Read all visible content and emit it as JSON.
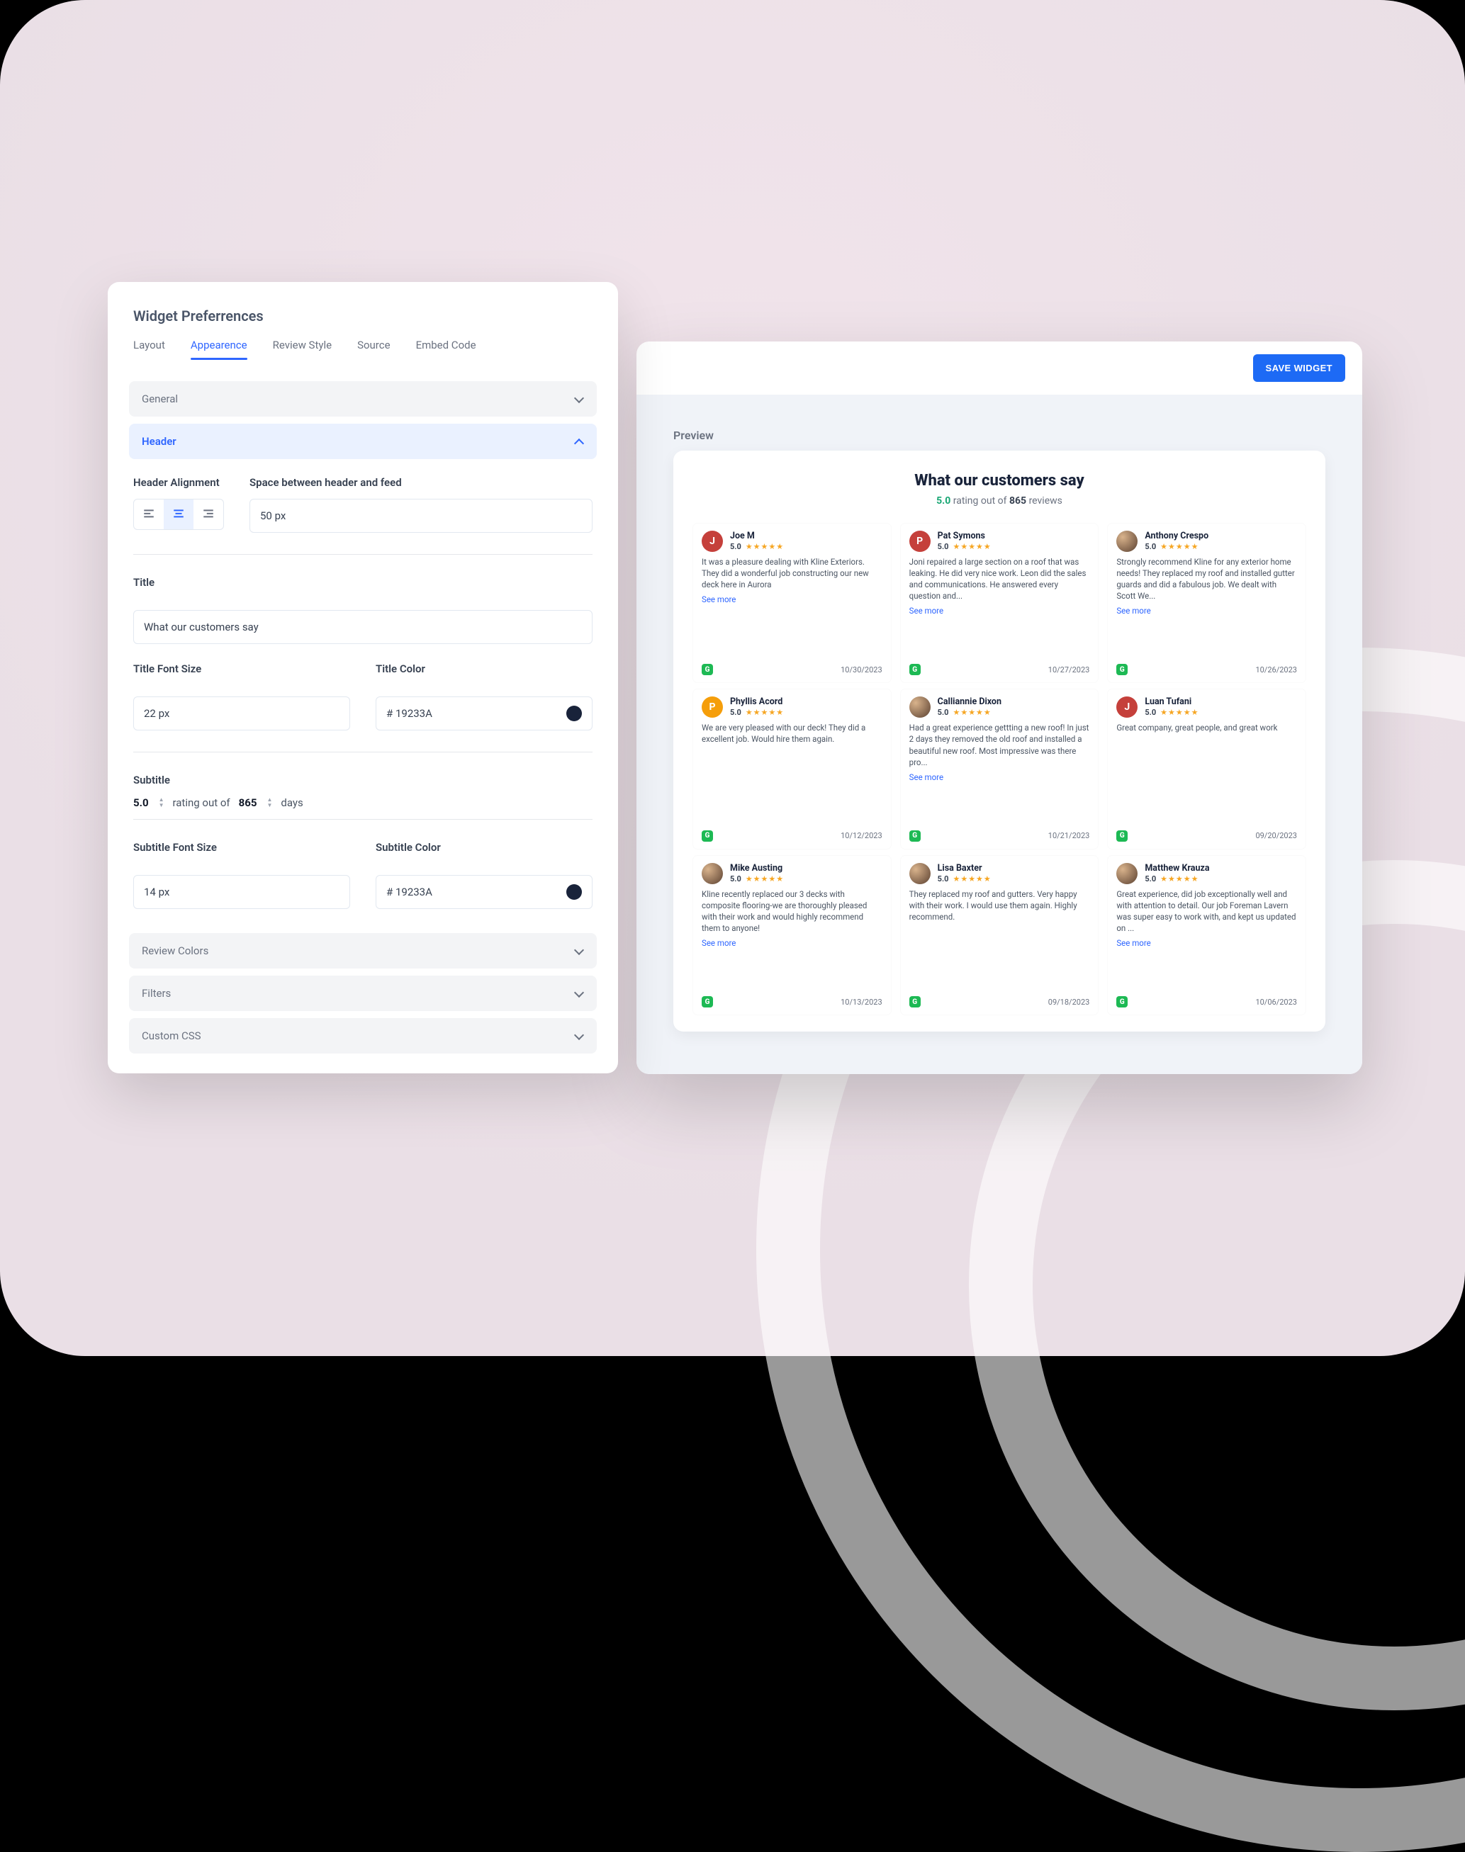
{
  "panel": {
    "title": "Widget Preferrences",
    "tabs": [
      "Layout",
      "Appearence",
      "Review Style",
      "Source",
      "Embed Code"
    ],
    "activeTab": 1,
    "sections": {
      "general": "General",
      "header": "Header",
      "review_colors": "Review Colors",
      "filters": "Filters",
      "custom_css": "Custom CSS"
    },
    "header_alignment_label": "Header Alignment",
    "space_label": "Space between header and feed",
    "space_value": "50 px",
    "title_label": "Title",
    "title_value": "What our customers say",
    "title_font_size_label": "Title Font Size",
    "title_font_size_value": "22 px",
    "title_color_label": "Title Color",
    "title_color_value": "# 19233A",
    "title_color_hex": "#19233A",
    "subtitle_label": "Subtitle",
    "subtitle_rating": "5.0",
    "subtitle_text1": "rating out of",
    "subtitle_count": "865",
    "subtitle_text2": "days",
    "subtitle_font_size_label": "Subtitle Font Size",
    "subtitle_font_size_value": "14 px",
    "subtitle_color_label": "Subtitle Color",
    "subtitle_color_value": "# 19233A",
    "subtitle_color_hex": "#19233A"
  },
  "preview": {
    "save_label": "SAVE WIDGET",
    "preview_label": "Preview",
    "widget_title": "What our customers say",
    "rating": "5.0",
    "rating_word": "rating out of",
    "count": "865",
    "reviews_word": "reviews",
    "see_more": "See more",
    "reviews": [
      {
        "name": "Joe M",
        "initial": "J",
        "color": "#c5403b",
        "score": "5.0",
        "text": "It was a pleasure dealing with Kline Exteriors. They did a wonderful job constructing our new deck here in Aurora",
        "seemore": true,
        "date": "10/30/2023",
        "src": "G"
      },
      {
        "name": "Pat Symons",
        "initial": "P",
        "color": "#c5403b",
        "score": "5.0",
        "text": "Joni repaired a large section on a roof that was leaking. He did very nice work. Leon did the sales and communications. He answered every question and...",
        "seemore": true,
        "date": "10/27/2023",
        "src": "G"
      },
      {
        "name": "Anthony Crespo",
        "initial": "",
        "photo": true,
        "score": "5.0",
        "text": "Strongly recommend Kline for any exterior home needs! They replaced my roof and installed gutter guards and did a fabulous job. We dealt with Scott We...",
        "seemore": true,
        "date": "10/26/2023",
        "src": "G"
      },
      {
        "name": "Phyllis Acord",
        "initial": "P",
        "color": "#f59e0b",
        "score": "5.0",
        "text": "We are very pleased with our deck! They did a excellent job. Would hire them again.",
        "seemore": false,
        "date": "10/12/2023",
        "src": "G"
      },
      {
        "name": "Calliannie Dixon",
        "initial": "",
        "photo": true,
        "score": "5.0",
        "text": "Had a great experience gettting a new roof! In just 2 days they removed the old roof and installed a beautiful new roof. Most impressive was there pro...",
        "seemore": true,
        "date": "10/21/2023",
        "src": "G"
      },
      {
        "name": "Luan Tufani",
        "initial": "J",
        "color": "#c5403b",
        "score": "5.0",
        "text": "Great company, great people, and great work",
        "seemore": false,
        "date": "09/20/2023",
        "src": "G"
      },
      {
        "name": "Mike Austing",
        "initial": "",
        "photo": true,
        "score": "5.0",
        "text": "Kline recently replaced our 3 decks with composite flooring-we are thoroughly pleased with their work and would highly recommend them to anyone!",
        "seemore": true,
        "date": "10/13/2023",
        "src": "G"
      },
      {
        "name": "Lisa Baxter",
        "initial": "",
        "photo": true,
        "score": "5.0",
        "text": "They replaced my roof and gutters. Very happy with their work. I would use them again. Highly recommend.",
        "seemore": false,
        "date": "09/18/2023",
        "src": "G"
      },
      {
        "name": "Matthew Krauza",
        "initial": "",
        "photo": true,
        "score": "5.0",
        "text": "Great experience, did job exceptionally well and with attention to detail. Our job Foreman Lavern was super easy to work with, and kept us updated on ...",
        "seemore": true,
        "date": "10/06/2023",
        "src": "G"
      }
    ]
  }
}
